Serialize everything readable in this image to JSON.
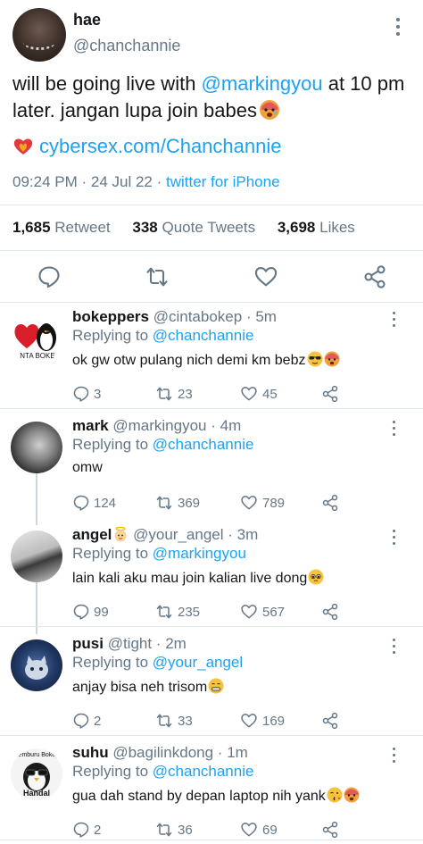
{
  "tweet": {
    "name": "hae",
    "handle": "@chanchannie",
    "text_before": "will be going live with ",
    "mention": "@markingyou",
    "text_after": " at 10 pm later. jangan lupa join babes",
    "link": "cybersex.com/Chanchannie",
    "time": "09:24 PM",
    "sep": " · ",
    "date": "24 Jul 22",
    "source": "twitter for iPhone"
  },
  "stats": {
    "retweets_count": "1,685",
    "retweets_label": "Retweet",
    "quotes_count": "338",
    "quotes_label": "Quote Tweets",
    "likes_count": "3,698",
    "likes_label": "Likes"
  },
  "actions": {
    "icons": [
      "reply-icon",
      "retweet-icon",
      "like-icon",
      "share-icon"
    ]
  },
  "replies": [
    {
      "name": "bokeppers",
      "handle": "@cintabokep",
      "time": "5m",
      "replying_label": "Replying to ",
      "replying_to": "@chanchannie",
      "text": "ok gw otw pulang nich demi km bebz",
      "avatar_text": "NTA BOKE",
      "replies": "3",
      "retweets": "23",
      "likes": "45"
    },
    {
      "name": "mark",
      "handle": "@markingyou",
      "time": "4m",
      "replying_label": "Replying to ",
      "replying_to": "@chanchannie",
      "text": "omw",
      "replies": "124",
      "retweets": "369",
      "likes": "789"
    },
    {
      "name": "angel",
      "handle": "@your_angel",
      "time": "3m",
      "replying_label": "Replying to ",
      "replying_to": "@markingyou",
      "text": "lain kali aku mau join kalian live dong",
      "replies": "99",
      "retweets": "235",
      "likes": "567"
    },
    {
      "name": "pusi",
      "handle": "@tight",
      "time": "2m",
      "replying_label": "Replying to ",
      "replying_to": "@your_angel",
      "text": "anjay bisa neh trisom",
      "replies": "2",
      "retweets": "33",
      "likes": "169"
    },
    {
      "name": "suhu",
      "handle": "@bagilinkdong",
      "time": "1m",
      "replying_label": "Replying to ",
      "replying_to": "@chanchannie",
      "text": "gua dah stand by depan laptop nih yank",
      "avatar_text_top": "Pemburu Bokep",
      "avatar_text_bottom": "Handal",
      "replies": "2",
      "retweets": "36",
      "likes": "69"
    }
  ],
  "colors": {
    "accent": "#1da1f2",
    "secondary_text": "#657786",
    "divider": "#e1e8ed",
    "thread_line": "#ccd6dd"
  }
}
